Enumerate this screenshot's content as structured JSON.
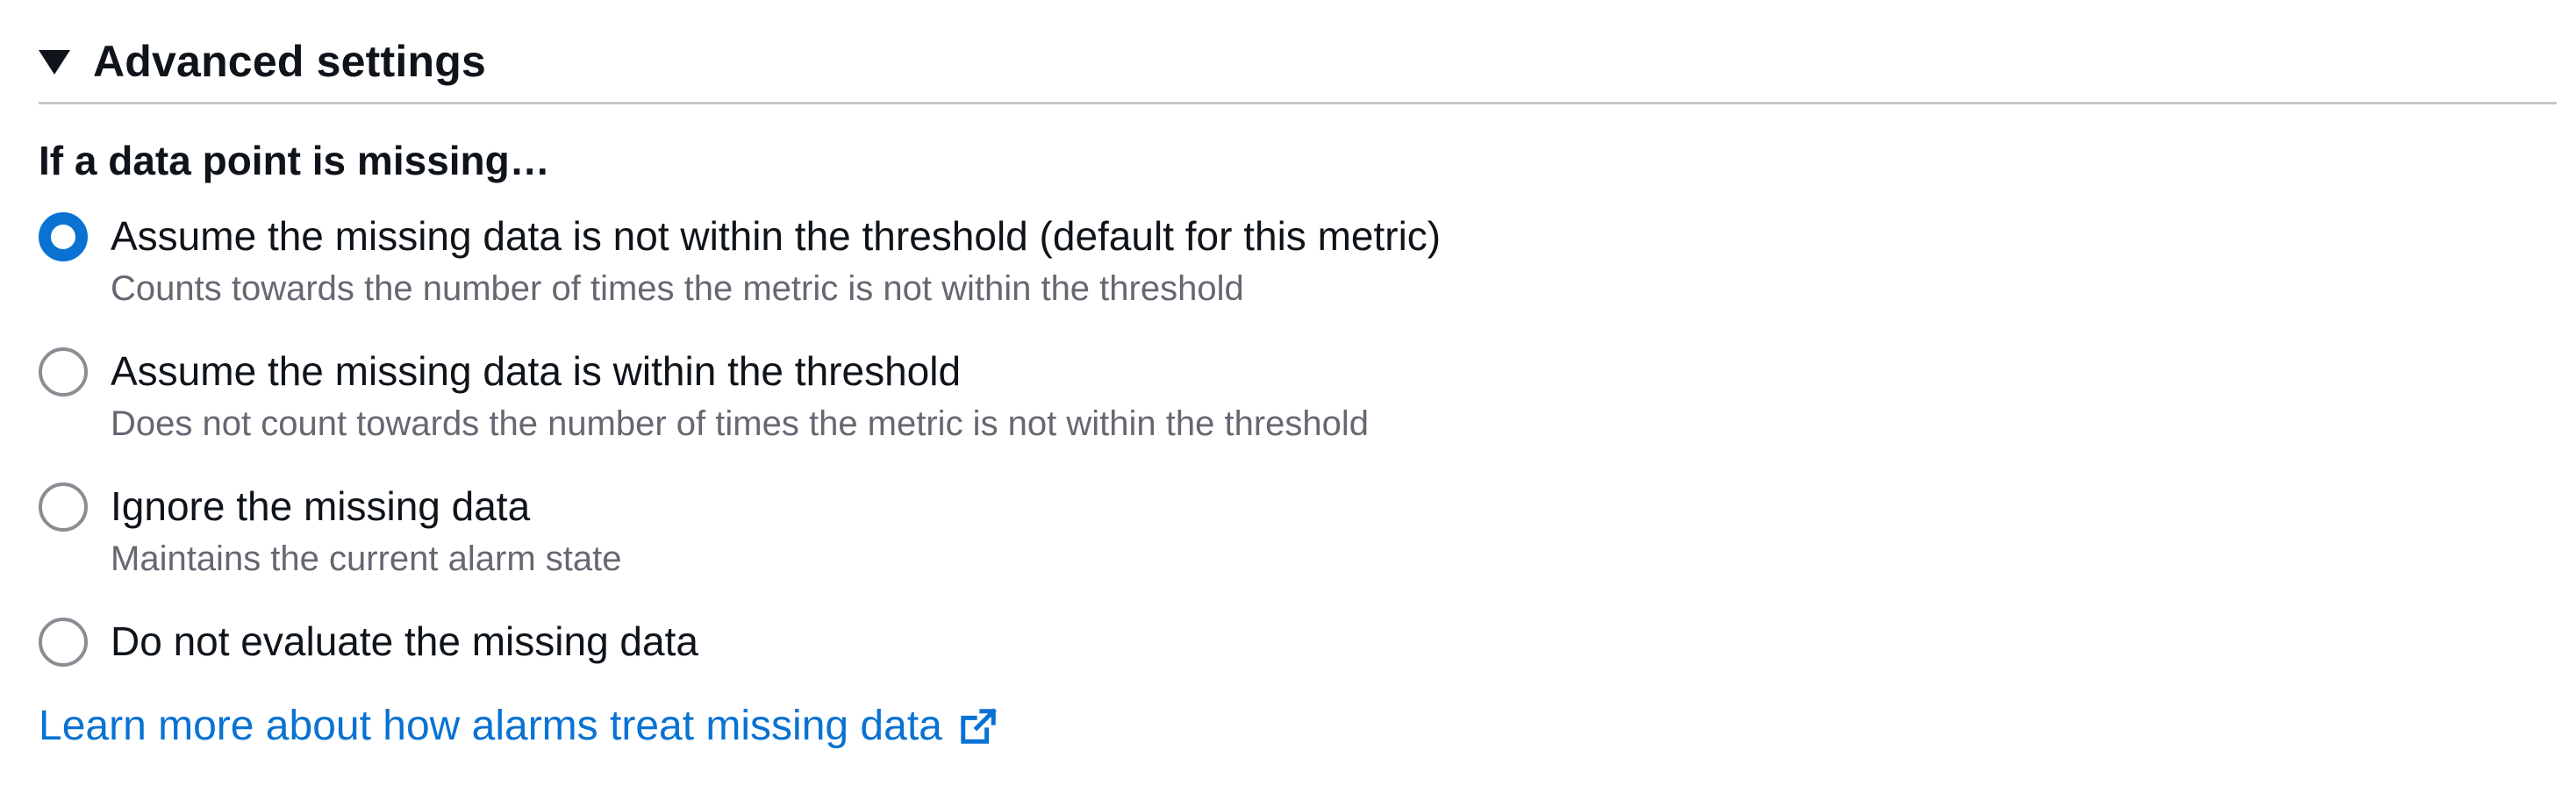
{
  "section": {
    "title": "Advanced settings",
    "expanded_icon": "caret-down-filled-icon"
  },
  "missing_data": {
    "group_label": "If a data point is missing…",
    "selected_index": 0,
    "options": [
      {
        "label": "Assume the missing data is not within the threshold (default for this metric)",
        "description": "Counts towards the number of times the metric is not within the threshold",
        "checked": true
      },
      {
        "label": "Assume the missing data is within the threshold",
        "description": "Does not count towards the number of times the metric is not within the threshold",
        "checked": false
      },
      {
        "label": "Ignore the missing data",
        "description": "Maintains the current alarm state",
        "checked": false
      },
      {
        "label": "Do not evaluate the missing data",
        "description": "",
        "checked": false
      }
    ]
  },
  "learn_more": {
    "text": "Learn more about how alarms treat missing data",
    "icon": "external-link-icon"
  },
  "colors": {
    "accent": "#0972d3",
    "text": "#0f141a",
    "secondary_text": "#656871",
    "divider": "#c6c6cd"
  }
}
